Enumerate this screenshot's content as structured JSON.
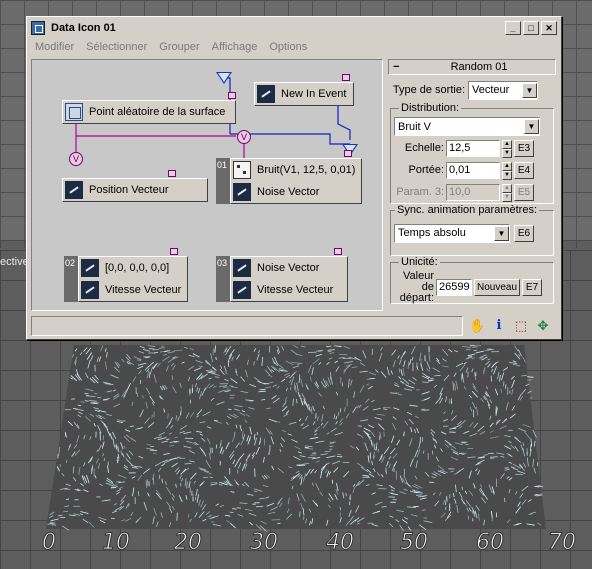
{
  "window": {
    "title": "Data Icon 01",
    "menu": [
      "Modifier",
      "Sélectionner",
      "Grouper",
      "Affichage",
      "Options"
    ]
  },
  "viewport": {
    "label": "ective",
    "axis_numbers": [
      "0",
      "10",
      "20",
      "30",
      "40",
      "50",
      "60",
      "70"
    ],
    "particle_color": "#d8f8ff"
  },
  "nodes": {
    "new_in_event": "New In Event",
    "surface": "Point aléatoire de la surface",
    "v1": "V",
    "v2": "V",
    "position_vecteur": "Position Vecteur",
    "bruit_tab": "01",
    "bruit_label": "Bruit(V1, 12,5, 0,01)",
    "noise_vector_1": "Noise Vector",
    "zero_tab": "02",
    "zero_label": "[0,0, 0,0, 0,0]",
    "vitesse_vecteur_1": "Vitesse Vecteur",
    "noise_tab": "03",
    "noise_vector_2": "Noise Vector",
    "vitesse_vecteur_2": "Vitesse Vecteur"
  },
  "panel": {
    "rollout_title": "Random 01",
    "minus": "−",
    "type_sortie_label": "Type de sortie:",
    "type_sortie_value": "Vecteur",
    "distribution_label": "Distribution:",
    "distribution_value": "Bruit V",
    "echelle_label": "Echelle:",
    "echelle_value": "12,5",
    "echelle_btn": "E3",
    "portee_label": "Portée:",
    "portee_value": "0,01",
    "portee_btn": "E4",
    "param3_label": "Param. 3:",
    "param3_value": "10,0",
    "param3_btn": "E5",
    "sync_label": "Sync. animation paramètres:",
    "sync_value": "Temps absolu",
    "sync_btn": "E6",
    "unicite_label": "Unicité:",
    "valeur_label_1": "Valeur de",
    "valeur_label_2": "départ:",
    "valeur_value": "26599",
    "nouveau_btn": "Nouveau",
    "e7_btn": "E7"
  },
  "colors": {
    "wire_magenta": "#b000a0",
    "wire_blue": "#1020c0"
  }
}
